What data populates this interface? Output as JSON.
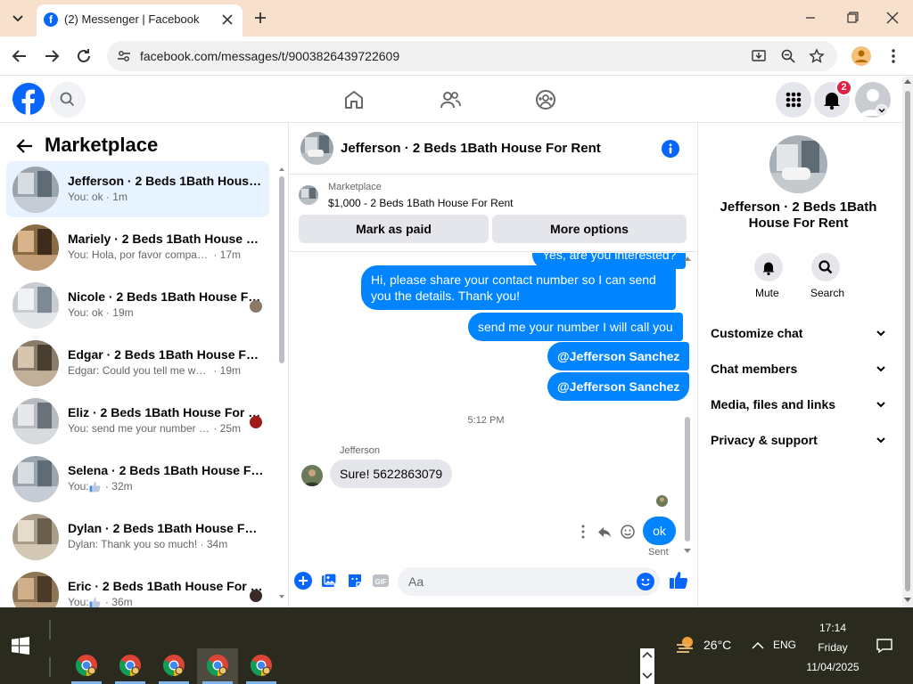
{
  "browser": {
    "tab_title": "(2) Messenger | Facebook",
    "url": "facebook.com/messages/t/9003826439722609"
  },
  "fb_header": {
    "notification_count": "2"
  },
  "left_panel": {
    "title": "Marketplace",
    "conversations": [
      {
        "title": "Jefferson · 2 Beds 1Bath House For Rent",
        "preview": "You: ok",
        "time": "1m",
        "active": true
      },
      {
        "title": "Mariely · 2 Beds 1Bath House For Rent",
        "preview": "You: Hola, por favor comparte tu ...",
        "time": "17m"
      },
      {
        "title": "Nicole · 2 Beds 1Bath House For Rent",
        "preview": "You: ok",
        "time": "19m"
      },
      {
        "title": "Edgar · 2 Beds 1Bath House For Rent",
        "preview": "Edgar: Could you tell me where t...",
        "time": "19m"
      },
      {
        "title": "Eliz · 2 Beds 1Bath House For Rent",
        "preview": "You: send me your number I w...",
        "time": "25m"
      },
      {
        "title": "Selena · 2 Beds 1Bath House For Rent",
        "preview": "You: ",
        "time": "32m"
      },
      {
        "title": "Dylan · 2 Beds 1Bath House For Rent",
        "preview": "Dylan: Thank you so much!",
        "time": "34m"
      },
      {
        "title": "Eric · 2 Beds 1Bath House For Rent",
        "preview": "You: ",
        "time": "36m"
      }
    ]
  },
  "chat": {
    "title": "Jefferson · 2 Beds 1Bath House For Rent",
    "marketplace_label": "Marketplace",
    "listing": "$1,000 - 2 Beds 1Bath House For Rent",
    "mark_paid": "Mark as paid",
    "more_options": "More options",
    "messages_out": [
      "Yes, are you interested?",
      "Hi, please share your contact number so I can send you the details. Thank you!",
      "send me your number I will call you",
      "@Jefferson Sanchez",
      "@Jefferson Sanchez"
    ],
    "timestamp": "5:12 PM",
    "sender_name": "Jefferson",
    "message_in": "Sure! 5622863079",
    "last_out": "ok",
    "status": "Sent",
    "composer_placeholder": "Aa"
  },
  "right_panel": {
    "name": "Jefferson · 2 Beds 1Bath House For Rent",
    "mute_label": "Mute",
    "search_label": "Search",
    "sections": [
      "Customize chat",
      "Chat members",
      "Media, files and links",
      "Privacy & support"
    ]
  },
  "taskbar": {
    "temperature": "26°C",
    "language": "ENG",
    "time": "17:14",
    "day": "Friday",
    "date": "11/04/2025"
  },
  "colors": {
    "fb_blue": "#0866ff",
    "messenger_blue": "#0084ff",
    "notification_red": "#e41e3f"
  }
}
